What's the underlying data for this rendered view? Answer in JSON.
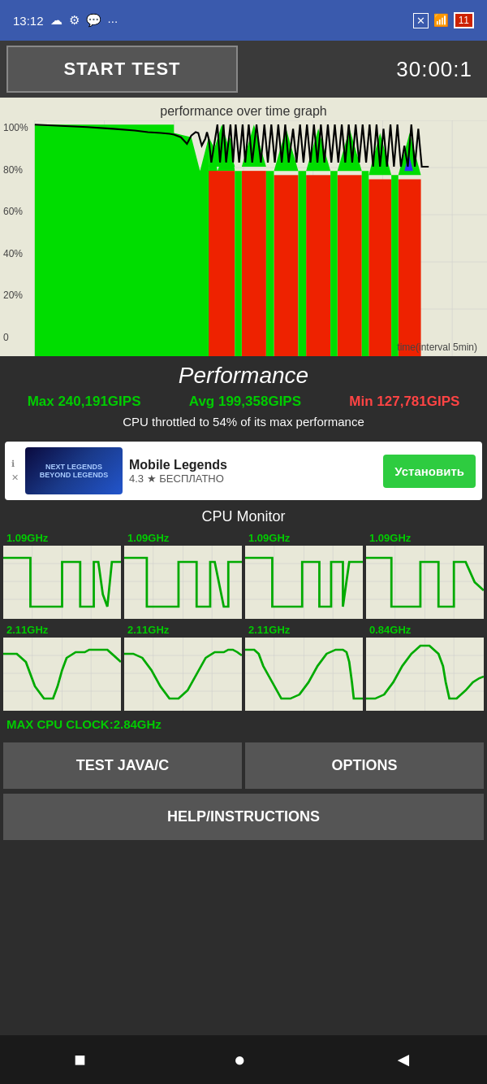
{
  "statusBar": {
    "time": "13:12",
    "batteryLevel": "11"
  },
  "topBar": {
    "startTestLabel": "START TEST",
    "timerDisplay": "30:00:1"
  },
  "graph": {
    "title": "performance over time graph",
    "yLabels": [
      "100%",
      "80%",
      "60%",
      "40%",
      "20%",
      "0"
    ],
    "xLabel": "time(interval 5min)"
  },
  "performance": {
    "title": "Performance",
    "maxLabel": "Max 240,191GIPS",
    "avgLabel": "Avg 199,358GIPS",
    "minLabel": "Min 127,781GIPS",
    "throttleText": "CPU throttled to 54% of its max performance"
  },
  "ad": {
    "name": "Mobile Legends",
    "rating": "4.3 ★ БЕСПЛАТНО",
    "installLabel": "Установить"
  },
  "cpuMonitor": {
    "title": "CPU Monitor",
    "cores": [
      {
        "freq": "1.09GHz",
        "row": 0
      },
      {
        "freq": "1.09GHz",
        "row": 0
      },
      {
        "freq": "1.09GHz",
        "row": 0
      },
      {
        "freq": "1.09GHz",
        "row": 0
      },
      {
        "freq": "2.11GHz",
        "row": 1
      },
      {
        "freq": "2.11GHz",
        "row": 1
      },
      {
        "freq": "2.11GHz",
        "row": 1
      },
      {
        "freq": "0.84GHz",
        "row": 1
      }
    ],
    "maxClockLabel": "MAX CPU CLOCK:2.84GHz"
  },
  "buttons": {
    "testJavaLabel": "TEST JAVA/C",
    "optionsLabel": "OPTIONS",
    "helpLabel": "HELP/INSTRUCTIONS"
  },
  "nav": {
    "square": "■",
    "circle": "●",
    "triangle": "◄"
  }
}
